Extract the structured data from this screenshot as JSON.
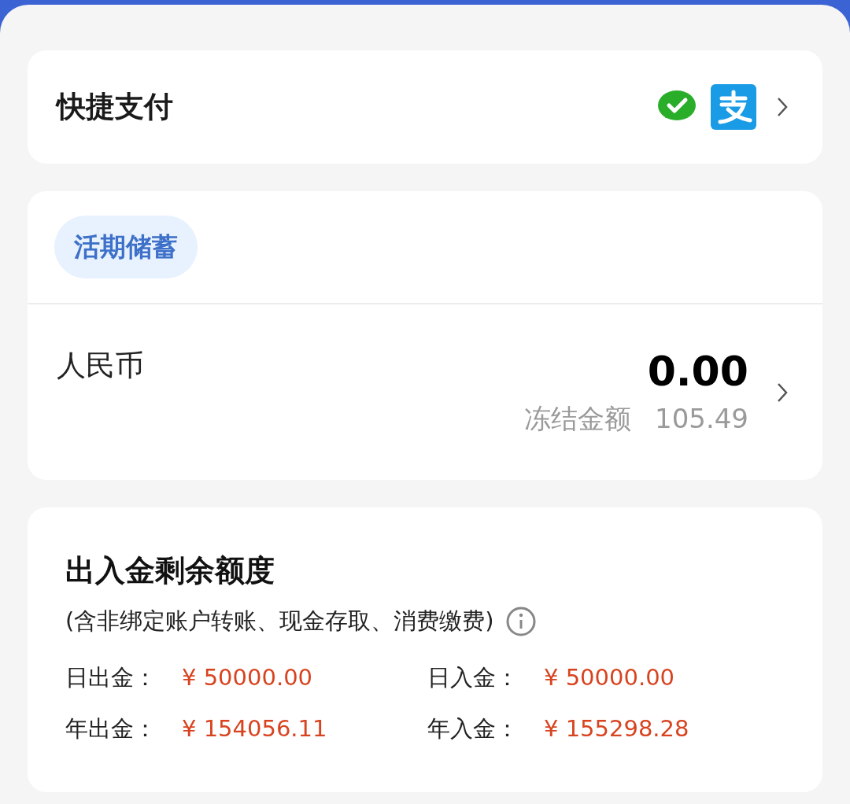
{
  "quick_pay": {
    "title": "快捷支付"
  },
  "savings": {
    "tab": {
      "label": "活期储蓄",
      "selected": true
    },
    "currency": "人民币",
    "balance": "0.00",
    "frozen_label": "冻结金额",
    "frozen_amount": "105.49"
  },
  "limits": {
    "title": "出入金剩余额度",
    "note": "(含非绑定账户转账、现金存取、消费缴费)",
    "items": [
      {
        "label": "日出金：",
        "value": "¥ 50000.00"
      },
      {
        "label": "日入金：",
        "value": "¥ 50000.00"
      },
      {
        "label": "年出金：",
        "value": "¥ 154056.11"
      },
      {
        "label": "年入金：",
        "value": "¥ 155298.28"
      }
    ]
  }
}
